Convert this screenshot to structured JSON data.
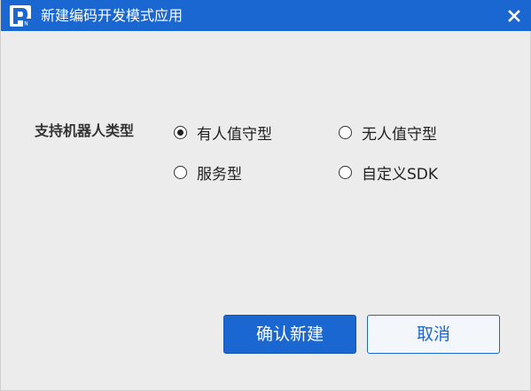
{
  "window": {
    "title": "新建编码开发模式应用",
    "logo_icon": "app-logo-icon",
    "close_icon": "close-icon"
  },
  "form": {
    "robot_type_label": "支持机器人类型",
    "options": [
      {
        "label": "有人值守型",
        "checked": true
      },
      {
        "label": "无人值守型",
        "checked": false
      },
      {
        "label": "服务型",
        "checked": false
      },
      {
        "label": "自定义SDK",
        "checked": false
      }
    ]
  },
  "buttons": {
    "confirm_label": "确认新建",
    "cancel_label": "取消"
  },
  "colors": {
    "accent": "#1b67d2",
    "background": "#ececec"
  }
}
